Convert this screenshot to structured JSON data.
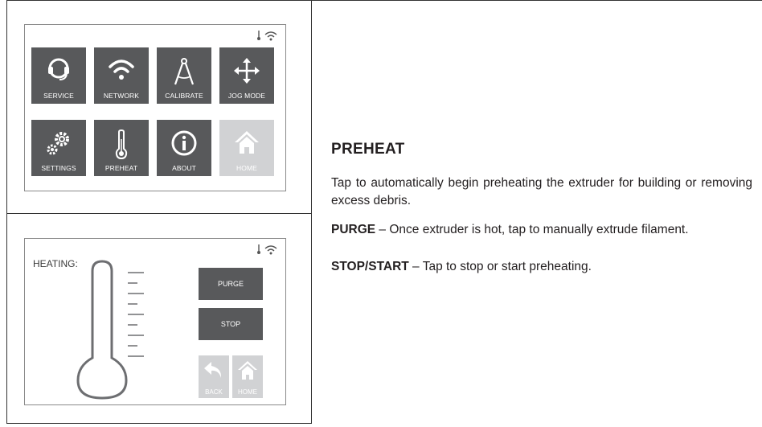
{
  "menu": {
    "tiles": [
      {
        "label": "SERVICE",
        "icon": "headset-icon",
        "style": "dark"
      },
      {
        "label": "NETWORK",
        "icon": "wifi-icon",
        "style": "dark"
      },
      {
        "label": "CALIBRATE",
        "icon": "compass-icon",
        "style": "dark"
      },
      {
        "label": "JOG MODE",
        "icon": "move-arrows-icon",
        "style": "dark"
      },
      {
        "label": "SETTINGS",
        "icon": "gears-icon",
        "style": "dark"
      },
      {
        "label": "PREHEAT",
        "icon": "thermometer-icon",
        "style": "dark"
      },
      {
        "label": "ABOUT",
        "icon": "info-icon",
        "style": "dark"
      },
      {
        "label": "HOME",
        "icon": "home-icon",
        "style": "light"
      }
    ]
  },
  "heat_screen": {
    "label": "HEATING:",
    "purge_label": "PURGE",
    "stop_label": "STOP",
    "back_label": "BACK",
    "home_label": "HOME"
  },
  "content": {
    "title": "PREHEAT",
    "intro": "Tap to automatically begin preheating the extruder for building or removing excess debris.",
    "purge_term": "PURGE",
    "purge_desc": " – Once extruder is hot, tap to manually extrude filament.",
    "stop_term": "STOP/START",
    "stop_desc": " – Tap to stop or start preheating."
  },
  "colors": {
    "tile_dark": "#58595b",
    "tile_light": "#d1d2d4"
  }
}
